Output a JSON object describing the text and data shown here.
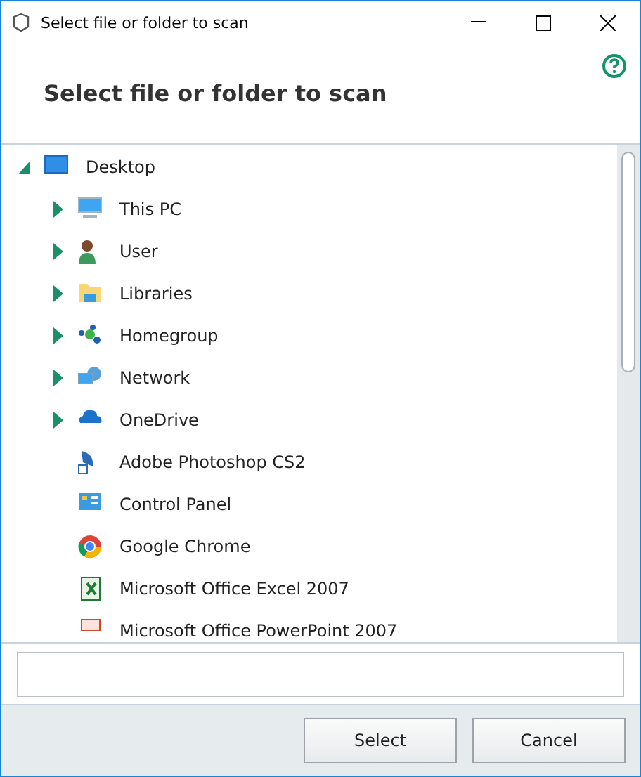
{
  "window": {
    "title": "Select file or folder to scan"
  },
  "heading": "Select file or folder to scan",
  "tree": [
    {
      "label": "Desktop",
      "kind": "folder",
      "expanded": true,
      "children": [
        {
          "label": "This PC",
          "kind": "folder",
          "expanded": false
        },
        {
          "label": "User",
          "kind": "folder",
          "expanded": false
        },
        {
          "label": "Libraries",
          "kind": "folder",
          "expanded": false
        },
        {
          "label": "Homegroup",
          "kind": "folder",
          "expanded": false
        },
        {
          "label": "Network",
          "kind": "folder",
          "expanded": false
        },
        {
          "label": "OneDrive",
          "kind": "folder",
          "expanded": false
        },
        {
          "label": "Adobe Photoshop CS2",
          "kind": "shortcut"
        },
        {
          "label": "Control Panel",
          "kind": "shortcut"
        },
        {
          "label": "Google Chrome",
          "kind": "shortcut"
        },
        {
          "label": "Microsoft Office Excel 2007",
          "kind": "shortcut"
        },
        {
          "label": "Microsoft Office PowerPoint 2007",
          "kind": "shortcut"
        }
      ]
    }
  ],
  "buttons": [
    "Select",
    "Cancel"
  ]
}
